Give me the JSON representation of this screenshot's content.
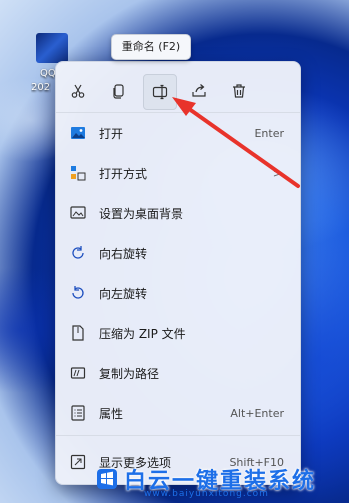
{
  "desktop": {
    "icon_label_line1": "QQ",
    "icon_label_line2": "2021"
  },
  "tooltip": {
    "text": "重命名 (F2)"
  },
  "toolbar": {
    "buttons": [
      {
        "name": "cut-button",
        "icon": "scissors-icon"
      },
      {
        "name": "copy-button",
        "icon": "copy-icon"
      },
      {
        "name": "rename-button",
        "icon": "rename-icon"
      },
      {
        "name": "share-button",
        "icon": "share-icon"
      },
      {
        "name": "delete-button",
        "icon": "trash-icon"
      }
    ]
  },
  "menu": {
    "items": [
      {
        "label": "打开",
        "accel": "Enter",
        "icon": "image-icon"
      },
      {
        "label": "打开方式",
        "accel": "",
        "submenu": ">",
        "icon": "open-with-icon"
      },
      {
        "label": "设置为桌面背景",
        "accel": "",
        "icon": "wallpaper-icon"
      },
      {
        "label": "向右旋转",
        "accel": "",
        "icon": "rotate-right-icon"
      },
      {
        "label": "向左旋转",
        "accel": "",
        "icon": "rotate-left-icon"
      },
      {
        "label": "压缩为 ZIP 文件",
        "accel": "",
        "icon": "zip-icon"
      },
      {
        "label": "复制为路径",
        "accel": "",
        "icon": "path-icon"
      },
      {
        "label": "属性",
        "accel": "Alt+Enter",
        "icon": "properties-icon"
      },
      {
        "label": "显示更多选项",
        "accel": "Shift+F10",
        "icon": "more-options-icon"
      }
    ]
  },
  "watermark": {
    "text": "白云一键重装系统",
    "url": "www.baiyunxitong.com"
  },
  "colors": {
    "accent": "#1d6fe8",
    "arrow": "#e8332b"
  }
}
